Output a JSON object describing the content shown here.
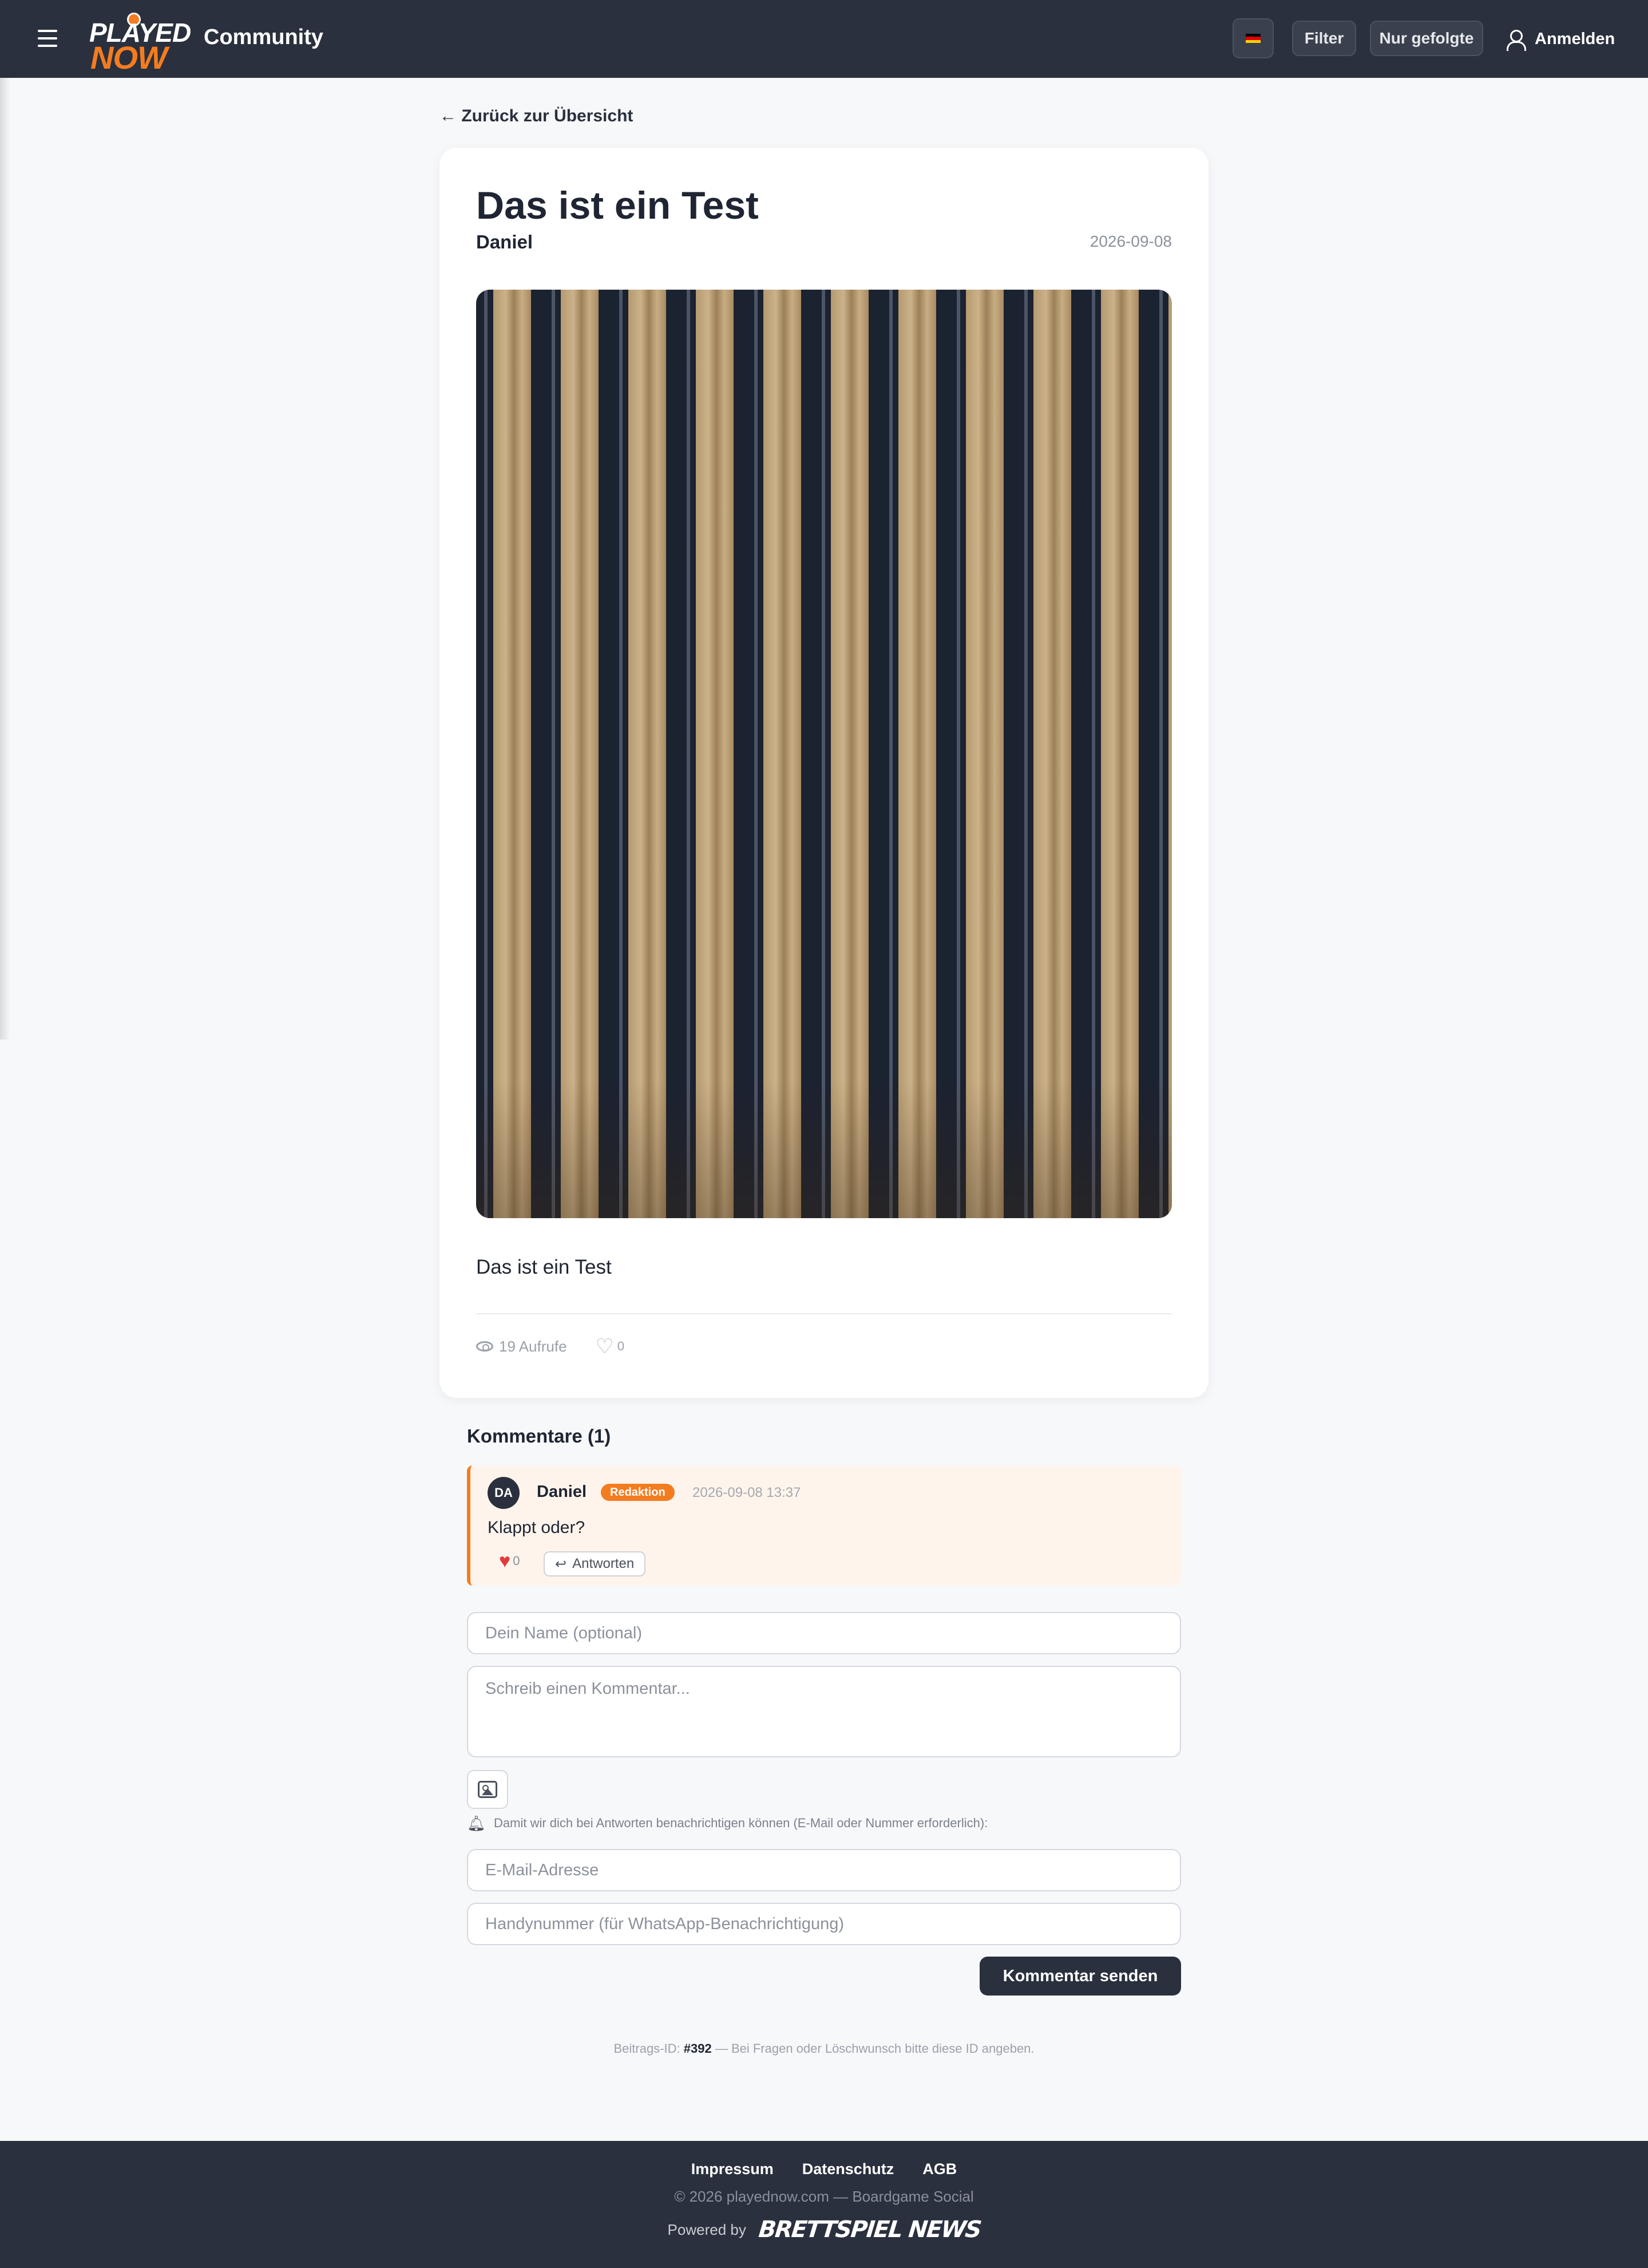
{
  "header": {
    "logo_top": "PLAYED",
    "logo_bottom": "NOW",
    "title": "Community",
    "language_flag": "flag-de-icon",
    "filter_label": "Filter",
    "followed_label": "Nur gefolgte",
    "login_label": "Anmelden"
  },
  "nav": {
    "back_label": "← Zurück zur Übersicht"
  },
  "post": {
    "title": "Das ist ein Test",
    "author": "Daniel",
    "date": "2026-09-08",
    "body": "Das ist ein Test",
    "views": "19 Aufrufe",
    "likes": "0"
  },
  "comments": {
    "heading": "Kommentare (1)",
    "items": [
      {
        "initials": "DA",
        "author": "Daniel",
        "badge": "Redaktion",
        "time": "2026-09-08 13:37",
        "text": "Klappt oder?",
        "likes": "0",
        "reply_label": "Antworten"
      }
    ]
  },
  "form": {
    "name_placeholder": "Dein Name (optional)",
    "comment_placeholder": "Schreib einen Kommentar...",
    "notify_note": "Damit wir dich bei Antworten benachrichtigen können (E-Mail oder Nummer erforderlich):",
    "email_placeholder": "E-Mail-Adresse",
    "phone_placeholder": "Handynummer (für WhatsApp-Benachrichtigung)",
    "submit_label": "Kommentar senden"
  },
  "post_id": {
    "prefix": "Beitrags-ID:",
    "id": "#392",
    "suffix": "— Bei Fragen oder Löschwunsch bitte diese ID angeben."
  },
  "footer": {
    "links": [
      "Impressum",
      "Datenschutz",
      "AGB"
    ],
    "copyright": "© 2026 playednow.com — Boardgame Social",
    "powered_by": "Powered by",
    "partner_logo": "BRETTSPIEL NEWS"
  },
  "colors": {
    "header_bg": "#2a303d",
    "accent": "#f47c20",
    "comment_bg": "#fef4ec",
    "like_red": "#e23a3a"
  }
}
